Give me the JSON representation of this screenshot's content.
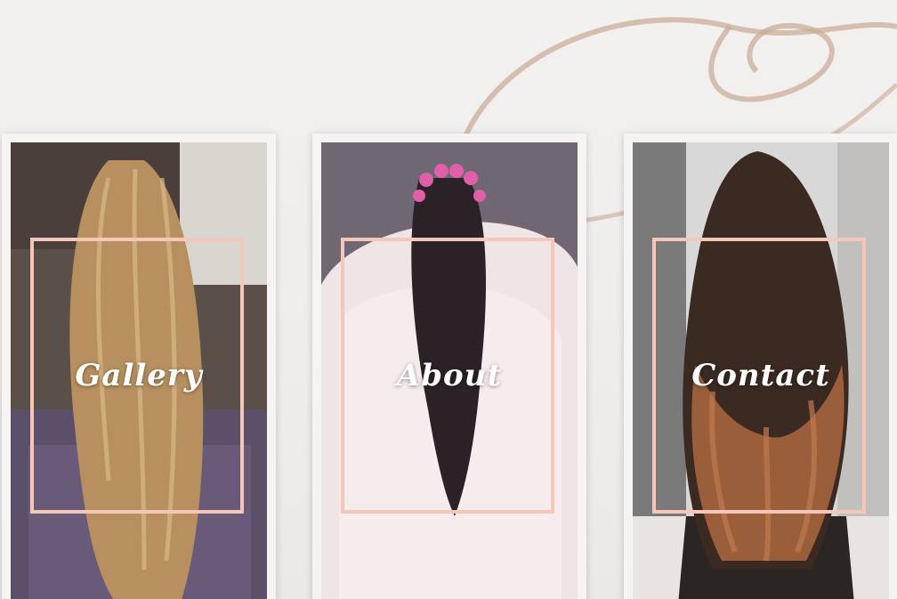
{
  "cards": [
    {
      "label": "Gallery"
    },
    {
      "label": "About"
    },
    {
      "label": "Contact"
    }
  ],
  "colors": {
    "frame": "#f6c7b8",
    "label": "#ffffff",
    "background": "#f0efed",
    "swirl": "#c9a896"
  },
  "decor": {
    "background_icon": "gold-swirl-ribbon"
  }
}
